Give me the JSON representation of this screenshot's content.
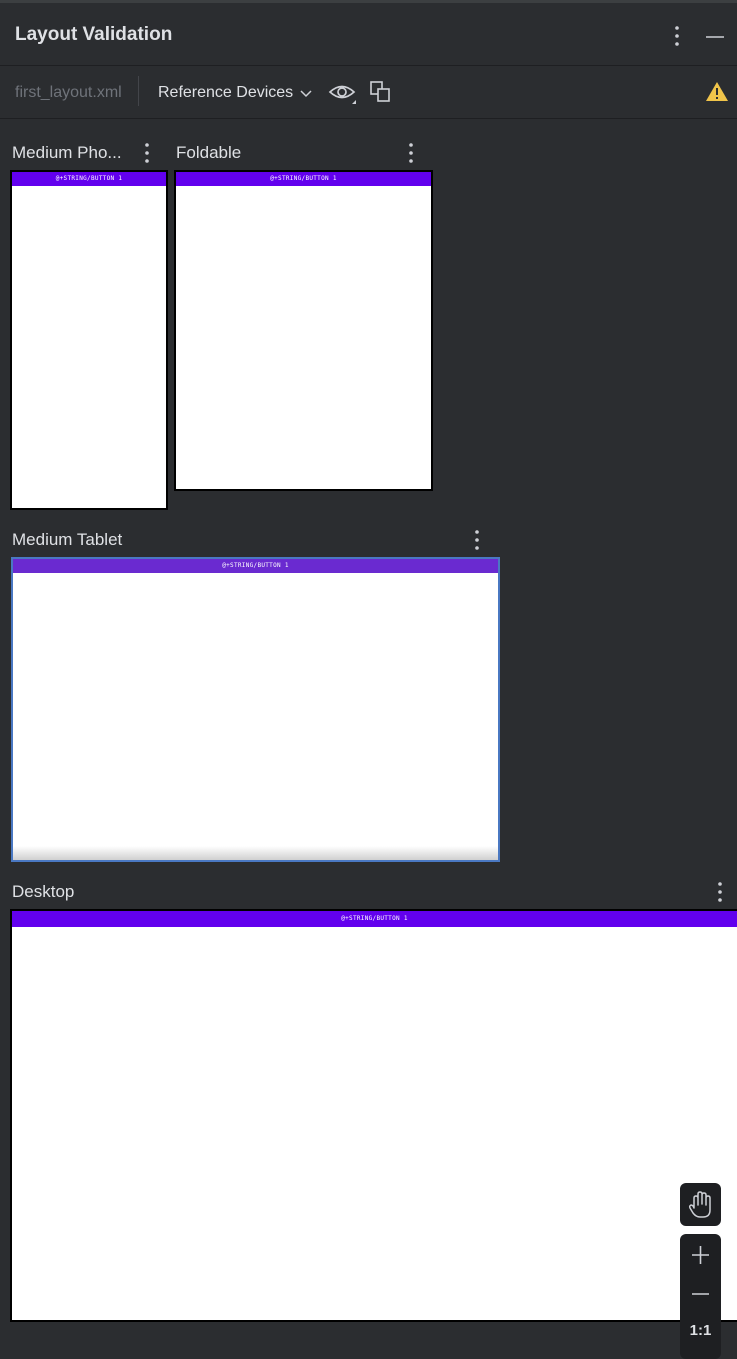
{
  "header": {
    "title": "Layout Validation"
  },
  "toolbar": {
    "file_name": "first_layout.xml",
    "device_set": "Reference Devices"
  },
  "devices": [
    {
      "label": "Medium Pho...",
      "app_bar_text": "@+STRING/BUTTON 1"
    },
    {
      "label": "Foldable",
      "app_bar_text": "@+STRING/BUTTON 1"
    },
    {
      "label": "Medium Tablet",
      "app_bar_text": "@+STRING/BUTTON 1"
    },
    {
      "label": "Desktop",
      "app_bar_text": "@+STRING/BUTTON 1"
    }
  ],
  "zoom": {
    "actual_size_label": "1:1"
  },
  "icons": [
    "more-vertical-icon",
    "minimize-icon",
    "chevron-down-icon",
    "eye-icon",
    "duplicate-icon",
    "warning-icon",
    "hand-icon",
    "plus-icon",
    "minus-icon"
  ],
  "colors": {
    "background": "#2b2d30",
    "app_bar": "#6200ee",
    "warning": "#f0c44a",
    "selection": "#4a78c2"
  }
}
